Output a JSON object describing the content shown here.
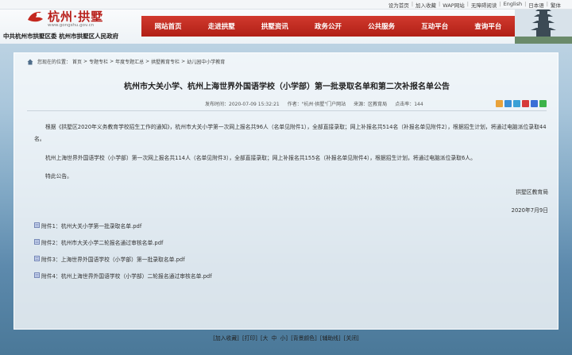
{
  "top_links": [
    "设为首页",
    "加入收藏",
    "WAP网站",
    "无障碍阅读",
    "English",
    "日本语",
    "繁体"
  ],
  "site": {
    "title": "杭州·拱墅",
    "url": "www.gongshu.gov.cn",
    "org": "中共杭州市拱墅区委  杭州市拱墅区人民政府"
  },
  "nav": [
    "网站首页",
    "走进拱墅",
    "拱墅资讯",
    "政务公开",
    "公共服务",
    "互动平台",
    "查询平台"
  ],
  "breadcrumb": [
    "您现在的位置：",
    "首页",
    "专题专栏",
    "年度专题汇总",
    "拱墅教育专栏",
    "幼儿园中小学教育"
  ],
  "article": {
    "title": "杭州市大关小学、杭州上海世界外国语学校（小学部）第一批录取名单和第二次补报名单公告",
    "published": "发布时间：2020-07-09 15:32:21",
    "author": "作者：\"杭州·拱墅\"门户网站",
    "source": "来源：区教育局",
    "hits": "点击率：144",
    "paragraphs": [
      "根据《拱墅区2020年义务教育学校招生工作的通知》，杭州市大关小学第一次网上报名共96人（名单见附件1），全部直接录取；网上补报名共514名（补报名单见附件2），根据招生计划，将通过电脑派位录取44名。",
      "杭州上海世界外国语学校（小学部）第一次网上报名共114人（名单见附件3），全部直接录取；网上补报名共155名（补报名单见附件4），根据招生计划，将通过电脑派位录取6人。",
      "特此公告。"
    ],
    "signature": "拱墅区教育局",
    "date": "2020年7月9日"
  },
  "attachments": [
    "附件1：杭州大关小学第一批录取名单.pdf",
    "附件2：杭州市大关小学二轮报名通过审核名单.pdf",
    "附件3：上海世界外国语学校（小学部）第一批录取名单.pdf",
    "附件4：杭州上海世界外国语学校（小学部）二轮报名通过审核名单.pdf"
  ],
  "footer": [
    "[加入收藏]",
    "[打印]",
    "[大",
    "中",
    "小]",
    "[背景颜色]",
    "[辅助线]",
    "[关闭]"
  ],
  "colors": {
    "nav": "#b11f16",
    "brand": "#b8201b"
  }
}
